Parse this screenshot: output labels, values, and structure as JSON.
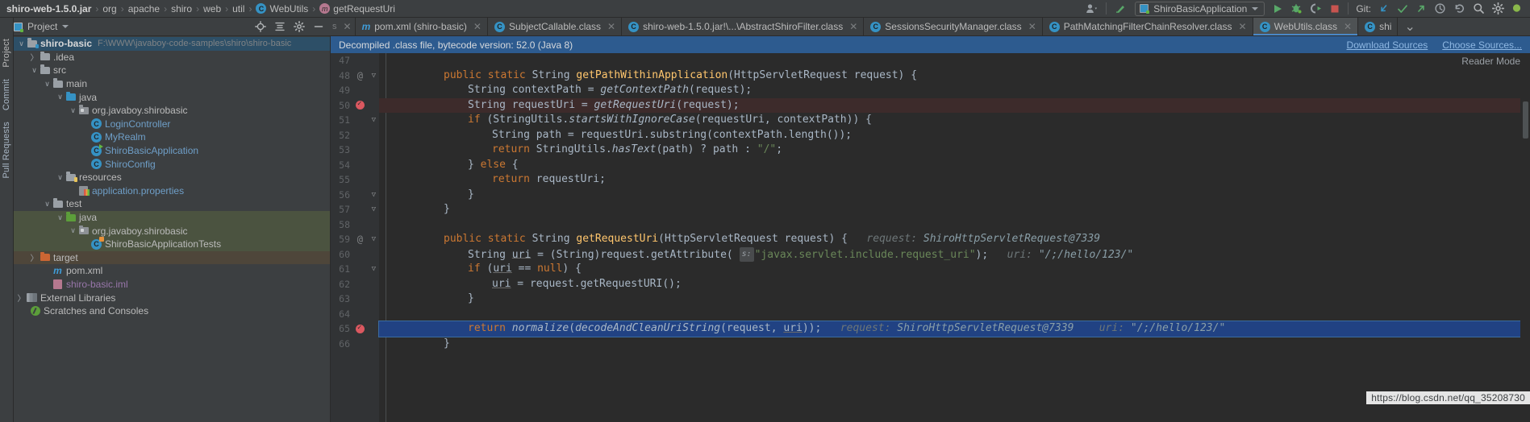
{
  "navbar": {
    "breadcrumbs": [
      {
        "label": "shiro-web-1.5.0.jar",
        "icon": "jar-icon",
        "bold": true
      },
      {
        "label": "org",
        "icon": "none"
      },
      {
        "label": "apache",
        "icon": "none"
      },
      {
        "label": "shiro",
        "icon": "none"
      },
      {
        "label": "web",
        "icon": "none"
      },
      {
        "label": "util",
        "icon": "none"
      },
      {
        "label": "WebUtils",
        "icon": "class-icon"
      },
      {
        "label": "getRequestUri",
        "icon": "method-icon"
      }
    ],
    "separator": "›",
    "run_config": "ShiroBasicApplication",
    "git_label": "Git:",
    "icons": [
      "user-avatar-icon",
      "updating-project-icon",
      "run-icon",
      "debug-icon",
      "run-with-coverage-icon",
      "stop-icon",
      "git-update-icon",
      "git-commit-icon",
      "git-push-icon",
      "git-history-icon",
      "git-rollback-icon",
      "search-everywhere-icon",
      "settings-icon"
    ]
  },
  "toolbar": {
    "project_label": "Project",
    "icons": [
      "locate-icon",
      "collapse-all-icon",
      "settings-gear-icon",
      "hide-icon"
    ]
  },
  "tabs": [
    {
      "label": "pom.xml (shiro-basic)",
      "icon": "maven-icon",
      "active": false,
      "closable": true
    },
    {
      "label": "SubjectCallable.class",
      "icon": "class-icon",
      "active": false,
      "closable": true
    },
    {
      "label": "shiro-web-1.5.0.jar!\\...\\AbstractShiroFilter.class",
      "icon": "class-icon",
      "active": false,
      "closable": true
    },
    {
      "label": "SessionsSecurityManager.class",
      "icon": "class-icon",
      "active": false,
      "closable": true
    },
    {
      "label": "PathMatchingFilterChainResolver.class",
      "icon": "class-icon",
      "active": false,
      "closable": true
    },
    {
      "label": "WebUtils.class",
      "icon": "class-icon",
      "active": true,
      "closable": true
    },
    {
      "label": "shi",
      "icon": "class-icon",
      "active": false,
      "closable": false
    }
  ],
  "tool_windows": [
    "Project",
    "Commit",
    "Pull Requests"
  ],
  "tree": [
    {
      "indent": 0,
      "arrow": "open",
      "icon": "module-folder",
      "label": "shiro-basic",
      "style": "bold",
      "path": "F:\\WWW\\javaboy-code-samples\\shiro\\shiro-basic",
      "row": "sel"
    },
    {
      "indent": 1,
      "arrow": "closed",
      "icon": "folder",
      "label": ".idea",
      "style": "plain",
      "path": "",
      "row": ""
    },
    {
      "indent": 1,
      "arrow": "open",
      "icon": "folder",
      "label": "src",
      "style": "plain",
      "path": "",
      "row": ""
    },
    {
      "indent": 2,
      "arrow": "open",
      "icon": "folder",
      "label": "main",
      "style": "plain",
      "path": "",
      "row": ""
    },
    {
      "indent": 3,
      "arrow": "open",
      "icon": "folder-src",
      "label": "java",
      "style": "plain",
      "path": "",
      "row": ""
    },
    {
      "indent": 4,
      "arrow": "open",
      "icon": "package",
      "label": "org.javaboy.shirobasic",
      "style": "plain",
      "path": "",
      "row": ""
    },
    {
      "indent": 5,
      "arrow": "none",
      "icon": "class",
      "label": "LoginController",
      "style": "blue",
      "path": "",
      "row": ""
    },
    {
      "indent": 5,
      "arrow": "none",
      "icon": "class",
      "label": "MyRealm",
      "style": "blue",
      "path": "",
      "row": ""
    },
    {
      "indent": 5,
      "arrow": "none",
      "icon": "class-run",
      "label": "ShiroBasicApplication",
      "style": "blue",
      "path": "",
      "row": ""
    },
    {
      "indent": 5,
      "arrow": "none",
      "icon": "class",
      "label": "ShiroConfig",
      "style": "blue",
      "path": "",
      "row": ""
    },
    {
      "indent": 3,
      "arrow": "open",
      "icon": "folder-res",
      "label": "resources",
      "style": "plain",
      "path": "",
      "row": ""
    },
    {
      "indent": 4,
      "arrow": "none",
      "icon": "properties",
      "label": "application.properties",
      "style": "blue",
      "path": "",
      "row": ""
    },
    {
      "indent": 2,
      "arrow": "open",
      "icon": "folder",
      "label": "test",
      "style": "plain",
      "path": "",
      "row": ""
    },
    {
      "indent": 3,
      "arrow": "open",
      "icon": "folder-test",
      "label": "java",
      "style": "plain",
      "path": "",
      "row": "hl-green"
    },
    {
      "indent": 4,
      "arrow": "open",
      "icon": "package",
      "label": "org.javaboy.shirobasic",
      "style": "plain",
      "path": "",
      "row": "hl-green"
    },
    {
      "indent": 5,
      "arrow": "none",
      "icon": "class-test",
      "label": "ShiroBasicApplicationTests",
      "style": "plain",
      "path": "",
      "row": "hl-green"
    },
    {
      "indent": 1,
      "arrow": "closed",
      "icon": "folder-target",
      "label": "target",
      "style": "plain",
      "path": "",
      "row": "hl-brown"
    },
    {
      "indent": 1,
      "arrow": "none",
      "icon": "maven",
      "label": "pom.xml",
      "style": "plain",
      "path": "",
      "row": ""
    },
    {
      "indent": 1,
      "arrow": "none",
      "icon": "iml",
      "label": "shiro-basic.iml",
      "style": "lav",
      "path": "",
      "row": ""
    },
    {
      "indent": 0,
      "arrow": "closed",
      "icon": "library",
      "label": "External Libraries",
      "style": "plain",
      "path": "",
      "row": ""
    },
    {
      "indent": 0,
      "arrow": "none",
      "icon": "scratch",
      "label": "Scratches and Consoles",
      "style": "plain",
      "path": "",
      "row": ""
    }
  ],
  "editor": {
    "banner_text": "Decompiled .class file, bytecode version: 52.0 (Java 8)",
    "banner_links": [
      "Download Sources",
      "Choose Sources..."
    ],
    "reader_mode": "Reader Mode",
    "first_line": 47,
    "lines": [
      {
        "n": 47,
        "at": false,
        "fold": "",
        "bp": false,
        "state": "",
        "indent": 0,
        "tokens": []
      },
      {
        "n": 48,
        "at": true,
        "fold": "end",
        "bp": false,
        "state": "",
        "indent": 1,
        "tokens": [
          [
            "kw",
            "public "
          ],
          [
            "kw",
            "static "
          ],
          [
            "cls",
            "String "
          ],
          [
            "mname",
            "getPathWithinApplication"
          ],
          [
            "cls",
            "(HttpServletRequest request) {"
          ]
        ]
      },
      {
        "n": 49,
        "at": false,
        "fold": "",
        "bp": false,
        "state": "",
        "indent": 2,
        "tokens": [
          [
            "cls",
            "String contextPath = "
          ],
          [
            "ital",
            "getContextPath"
          ],
          [
            "cls",
            "(request);"
          ]
        ]
      },
      {
        "n": 50,
        "at": false,
        "fold": "",
        "bp": true,
        "state": "err",
        "indent": 2,
        "tokens": [
          [
            "cls",
            "String requestUri = "
          ],
          [
            "ital",
            "getRequestUri"
          ],
          [
            "cls",
            "(request);"
          ]
        ]
      },
      {
        "n": 51,
        "at": false,
        "fold": "end",
        "bp": false,
        "state": "",
        "indent": 2,
        "tokens": [
          [
            "kw",
            "if "
          ],
          [
            "cls",
            "(StringUtils."
          ],
          [
            "ital",
            "startsWithIgnoreCase"
          ],
          [
            "cls",
            "(requestUri, contextPath)) {"
          ]
        ]
      },
      {
        "n": 52,
        "at": false,
        "fold": "",
        "bp": false,
        "state": "",
        "indent": 3,
        "tokens": [
          [
            "cls",
            "String path = requestUri.substring(contextPath.length());"
          ]
        ]
      },
      {
        "n": 53,
        "at": false,
        "fold": "",
        "bp": false,
        "state": "",
        "indent": 3,
        "tokens": [
          [
            "kw",
            "return "
          ],
          [
            "cls",
            "StringUtils."
          ],
          [
            "ital",
            "hasText"
          ],
          [
            "cls",
            "(path) ? path : "
          ],
          [
            "str",
            "\"/\""
          ],
          [
            "cls",
            ";"
          ]
        ]
      },
      {
        "n": 54,
        "at": false,
        "fold": "",
        "bp": false,
        "state": "",
        "indent": 2,
        "tokens": [
          [
            "cls",
            "} "
          ],
          [
            "kw",
            "else "
          ],
          [
            "cls",
            "{"
          ]
        ]
      },
      {
        "n": 55,
        "at": false,
        "fold": "",
        "bp": false,
        "state": "",
        "indent": 3,
        "tokens": [
          [
            "kw",
            "return "
          ],
          [
            "cls",
            "requestUri;"
          ]
        ]
      },
      {
        "n": 56,
        "at": false,
        "fold": "end",
        "bp": false,
        "state": "",
        "indent": 2,
        "tokens": [
          [
            "cls",
            "}"
          ]
        ]
      },
      {
        "n": 57,
        "at": false,
        "fold": "end",
        "bp": false,
        "state": "",
        "indent": 1,
        "tokens": [
          [
            "cls",
            "}"
          ]
        ]
      },
      {
        "n": 58,
        "at": false,
        "fold": "",
        "bp": false,
        "state": "",
        "indent": 0,
        "tokens": []
      },
      {
        "n": 59,
        "at": true,
        "fold": "end",
        "bp": false,
        "state": "",
        "indent": 1,
        "tokens": [
          [
            "kw",
            "public "
          ],
          [
            "kw",
            "static "
          ],
          [
            "cls",
            "String "
          ],
          [
            "mname",
            "getRequestUri"
          ],
          [
            "cls",
            "(HttpServletRequest request) {"
          ],
          [
            "hint",
            "   request: "
          ],
          [
            "hintval",
            "ShiroHttpServletRequest@7339"
          ]
        ]
      },
      {
        "n": 60,
        "at": false,
        "fold": "",
        "bp": false,
        "state": "",
        "indent": 2,
        "tokens": [
          [
            "cls",
            "String "
          ],
          [
            "uline",
            "uri"
          ],
          [
            "cls",
            " = (String)request.getAttribute( "
          ],
          [
            "pbadge",
            "s:"
          ],
          [
            "str",
            "\"javax.servlet.include.request_uri\""
          ],
          [
            "cls",
            ");"
          ],
          [
            "hint",
            "   uri: "
          ],
          [
            "hintval",
            "\"/;/hello/123/\""
          ]
        ]
      },
      {
        "n": 61,
        "at": false,
        "fold": "end",
        "bp": false,
        "state": "",
        "indent": 2,
        "tokens": [
          [
            "kw",
            "if "
          ],
          [
            "cls",
            "("
          ],
          [
            "uline",
            "uri"
          ],
          [
            "cls",
            " == "
          ],
          [
            "kw",
            "null"
          ],
          [
            "cls",
            ") {"
          ]
        ]
      },
      {
        "n": 62,
        "at": false,
        "fold": "",
        "bp": false,
        "state": "",
        "indent": 3,
        "tokens": [
          [
            "uline",
            "uri"
          ],
          [
            "cls",
            " = request.getRequestURI();"
          ]
        ]
      },
      {
        "n": 63,
        "at": false,
        "fold": "",
        "bp": false,
        "state": "",
        "indent": 2,
        "tokens": [
          [
            "cls",
            "}"
          ]
        ]
      },
      {
        "n": 64,
        "at": false,
        "fold": "",
        "bp": false,
        "state": "",
        "indent": 0,
        "tokens": []
      },
      {
        "n": 65,
        "at": false,
        "fold": "",
        "bp": true,
        "state": "selline",
        "indent": 2,
        "tokens": [
          [
            "kw",
            "return "
          ],
          [
            "ital",
            "normalize"
          ],
          [
            "cls",
            "("
          ],
          [
            "ital",
            "decodeAndCleanUriString"
          ],
          [
            "cls",
            "(request, "
          ],
          [
            "uline",
            "uri"
          ],
          [
            "cls",
            "));"
          ],
          [
            "hint",
            "   request: "
          ],
          [
            "hintval",
            "ShiroHttpServletRequest@7339"
          ],
          [
            "hint",
            "    uri: "
          ],
          [
            "hintval",
            "\"/;/hello/123/\""
          ]
        ]
      },
      {
        "n": 66,
        "at": false,
        "fold": "",
        "bp": false,
        "state": "",
        "indent": 1,
        "tokens": [
          [
            "cls",
            "}"
          ]
        ]
      }
    ]
  },
  "watermark": "https://blog.csdn.net/qq_35208730",
  "colors": {
    "accent_blue": "#2d5b8f",
    "selection_blue": "#214283",
    "breakpoint_red": "#db5860",
    "keyword_orange": "#cc7832",
    "string_green": "#6a8759",
    "method_yellow": "#ffc66d",
    "tree_selection": "#2d4f67",
    "test_highlight": "#4b5340",
    "target_highlight": "#4e463a"
  }
}
